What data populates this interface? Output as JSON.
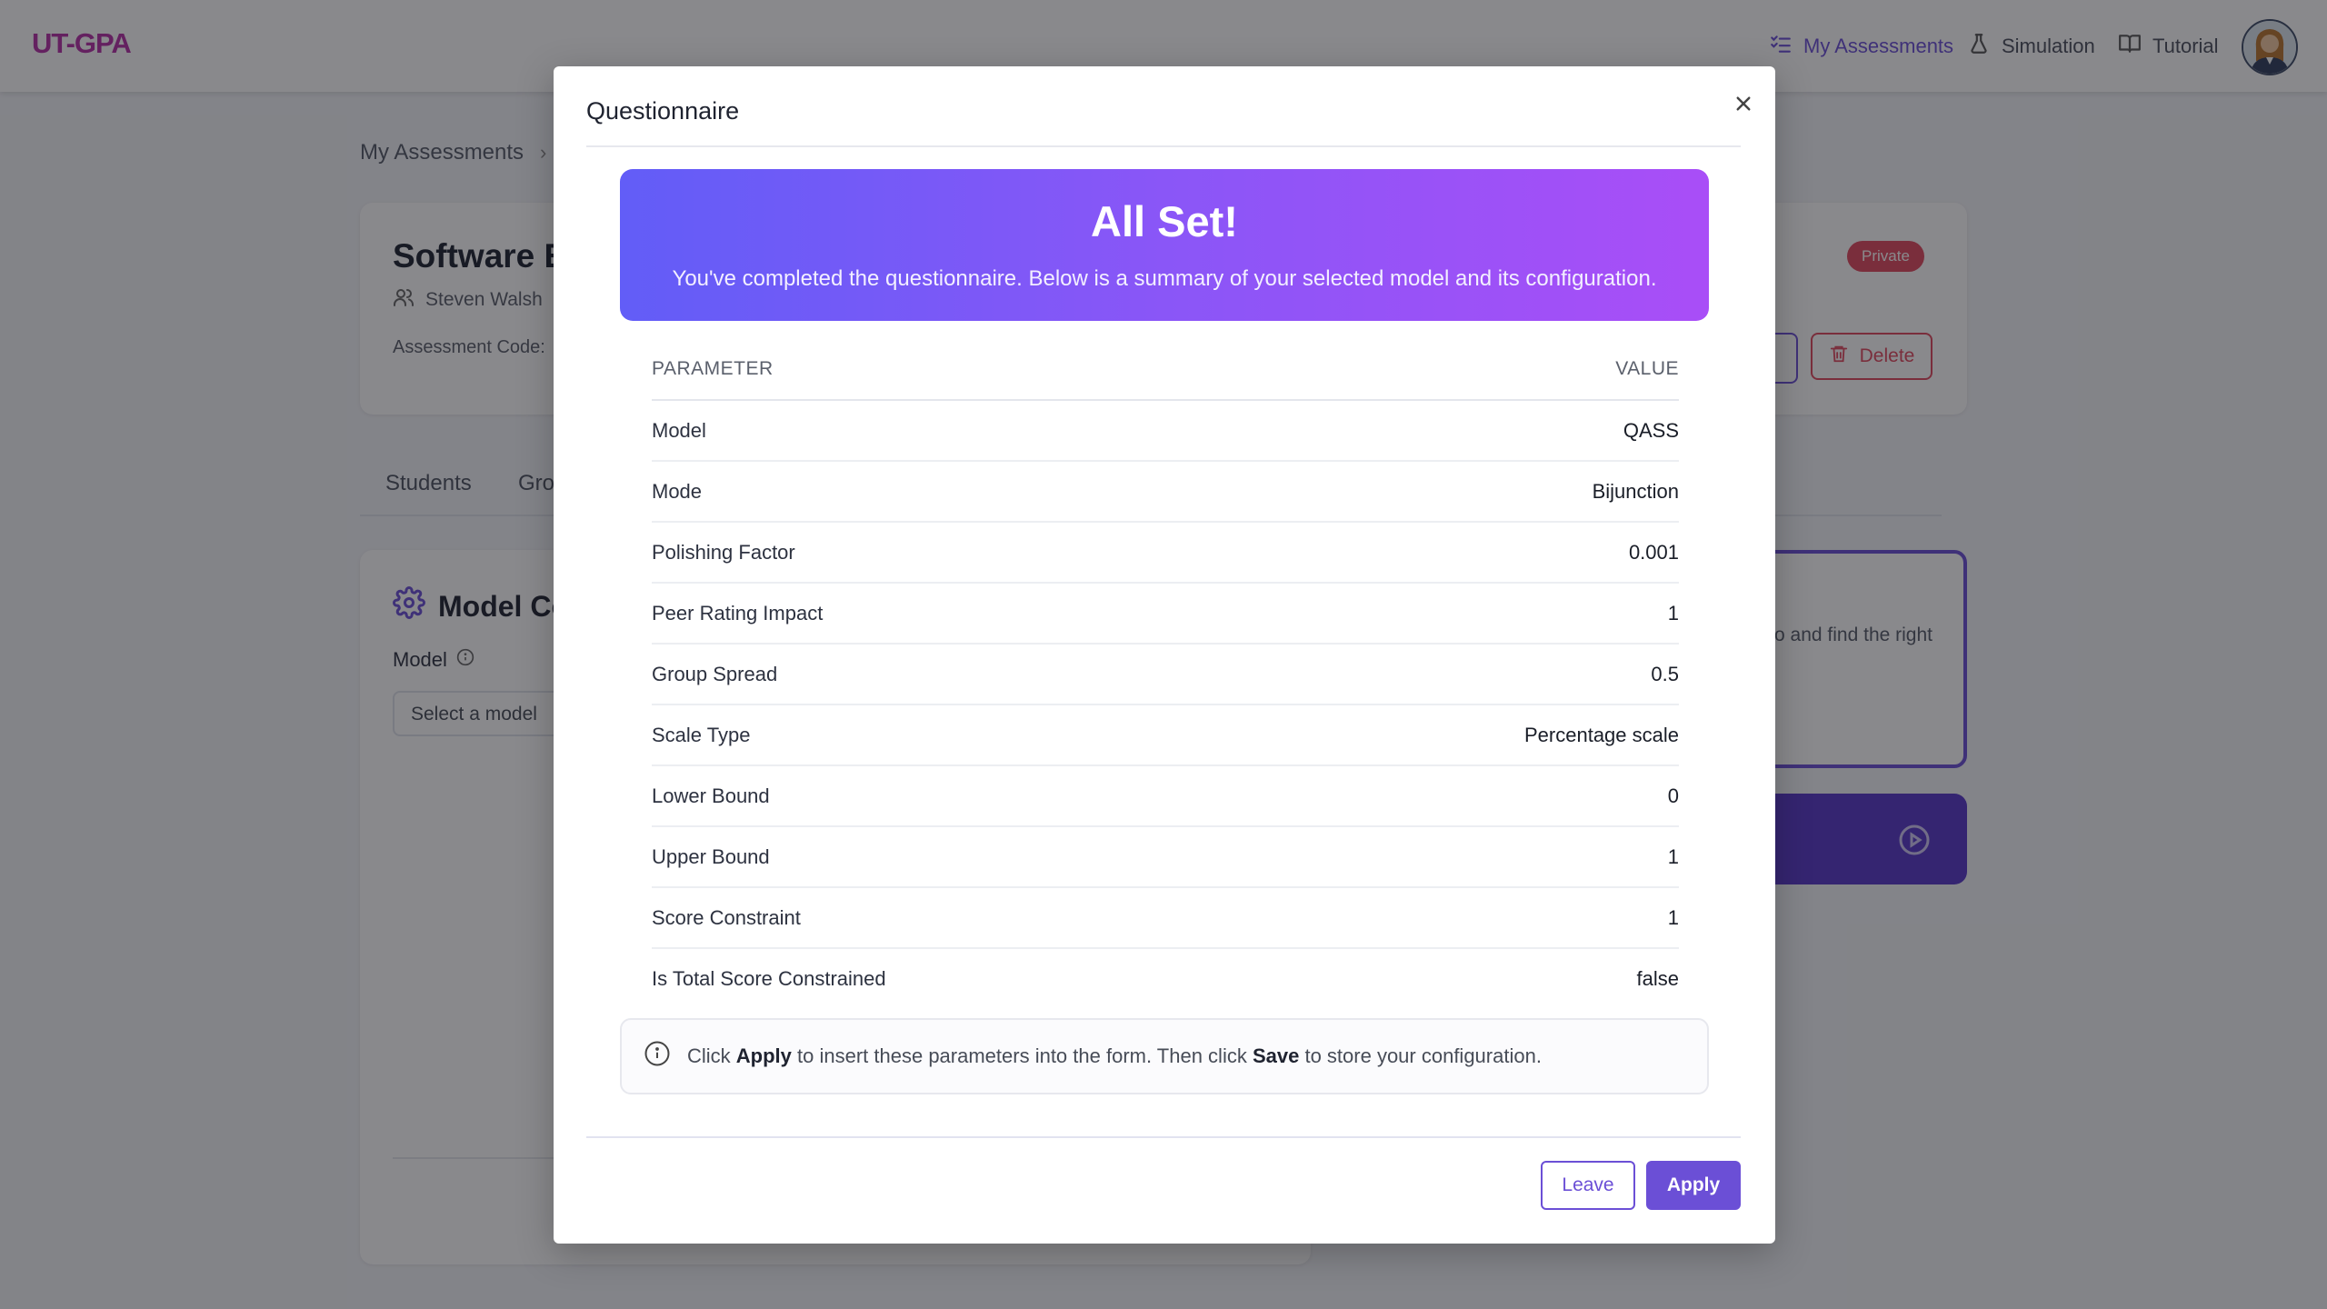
{
  "navbar": {
    "brand": "UT-GPA",
    "items": [
      {
        "label": "My Assessments",
        "icon": "list-check-icon",
        "active": true
      },
      {
        "label": "Simulation",
        "icon": "flask-icon",
        "active": false
      },
      {
        "label": "Tutorial",
        "icon": "book-open-icon",
        "active": false
      }
    ],
    "avatar_icon": "user-avatar-icon"
  },
  "background": {
    "breadcrumb": "My Assessments",
    "course_title": "Software E",
    "owner": "Steven Walsh",
    "assessment_code_label": "Assessment Code:",
    "private_badge": "Private",
    "delete_label": "Delete",
    "tabs": [
      "Students",
      "Gro"
    ],
    "model_title": "Model Co",
    "model_label": "Model",
    "model_placeholder": "Select a model",
    "help_text": "o and find the right"
  },
  "modal": {
    "title": "Questionnaire",
    "hero_title": "All Set!",
    "hero_subtitle": "You've completed the questionnaire. Below is a summary of your selected model and its configuration.",
    "table_headers": {
      "parameter": "PARAMETER",
      "value": "VALUE"
    },
    "rows": [
      {
        "name": "Model",
        "value": "QASS"
      },
      {
        "name": "Mode",
        "value": "Bijunction"
      },
      {
        "name": "Polishing Factor",
        "value": "0.001"
      },
      {
        "name": "Peer Rating Impact",
        "value": "1"
      },
      {
        "name": "Group Spread",
        "value": "0.5"
      },
      {
        "name": "Scale Type",
        "value": "Percentage scale"
      },
      {
        "name": "Lower Bound",
        "value": "0"
      },
      {
        "name": "Upper Bound",
        "value": "1"
      },
      {
        "name": "Score Constraint",
        "value": "1"
      },
      {
        "name": "Is Total Score Constrained",
        "value": "false"
      }
    ],
    "note": {
      "t1": "Click ",
      "apply_word": "Apply",
      "t2": " to insert these parameters into the form. Then click ",
      "save_word": "Save",
      "t3": " to store your configuration."
    },
    "leave_label": "Leave",
    "apply_label": "Apply"
  },
  "colors": {
    "accent": "#6b4fd6",
    "danger": "#e0485e",
    "brand": "#b52fa6"
  }
}
